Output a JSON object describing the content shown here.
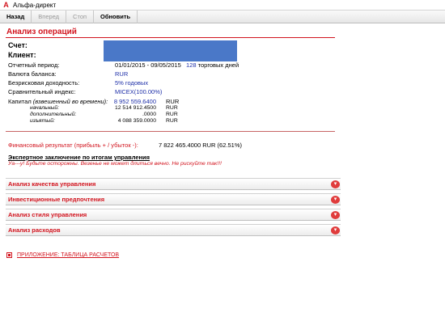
{
  "window": {
    "title": "Альфа-директ",
    "logo_glyph": "A"
  },
  "toolbar": {
    "back_label": "Назад",
    "forward_label": "Вперед",
    "stop_label": "Стоп",
    "refresh_label": "Обновить"
  },
  "report": {
    "title": "Анализ операций",
    "account_label": "Счет:",
    "client_label": "Клиент:",
    "period": {
      "label": "Отчетный период:",
      "value": "01/01/2015 - 09/05/2015",
      "days": "128",
      "days_suffix": "торговых дней"
    },
    "currency": {
      "label": "Валюта баланса:",
      "value": "RUR"
    },
    "riskfree": {
      "label": "Безрисковая доходность:",
      "value": "5% годовых"
    },
    "benchmark": {
      "label": "Сравнительный индекс:",
      "value": "MICEX(100.00%)"
    },
    "capital": {
      "label": "Капитал",
      "label_note": "(взвешенный во времени):",
      "value": "8 952 559.6400",
      "currency": "RUR",
      "initial_label": "начальный:",
      "initial_value": "12 514 912.4500",
      "initial_currency": "RUR",
      "additional_label": "дополнительный:",
      "additional_value": ".0000",
      "additional_currency": "RUR",
      "withdrawn_label": "изъятый:",
      "withdrawn_value": "4 088 359.0000",
      "withdrawn_currency": "RUR"
    },
    "financial_result": {
      "label": "Финансовый результат (прибыль + / убыток -):",
      "value": "7 822 465.4000 RUR  (62.51%)"
    },
    "expert": {
      "title": "Экспертное заключение по итогам управления",
      "text": "Уа---у! Будьте осторожны. Везенье не может длиться вечно. Не рискуйте так!!!"
    },
    "sections": [
      {
        "title": "Анализ качества управления"
      },
      {
        "title": "Инвестиционные предпочтения"
      },
      {
        "title": "Анализ стиля управления"
      },
      {
        "title": "Анализ расходов"
      }
    ],
    "appendix_link": "ПРИЛОЖЕНИЕ: ТАБЛИЦА РАСЧЕТОВ",
    "chevron_glyph": "▾"
  },
  "colors": {
    "accent_red": "#d2141e",
    "value_blue": "#1e2fa8",
    "redaction_blue": "#4a78c8"
  },
  "icons": {
    "logo": "alfa-logo-icon",
    "section_toggle": "chevron-down-icon",
    "appendix": "appendix-square-icon"
  }
}
